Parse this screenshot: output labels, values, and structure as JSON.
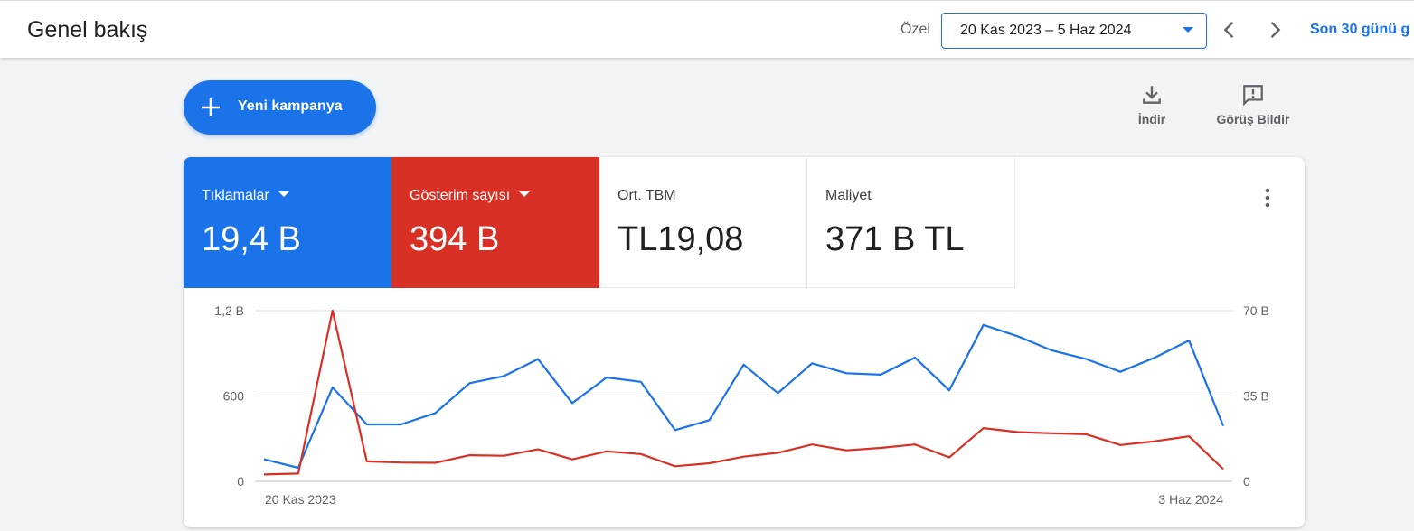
{
  "header": {
    "title": "Genel bakış",
    "date_type": "Özel",
    "date_range": "20 Kas 2023 – 5 Haz 2024",
    "quick_range": "Son 30 günü g"
  },
  "actions": {
    "new_campaign": "Yeni kampanya",
    "download": "İndir",
    "feedback": "Görüş Bildir"
  },
  "metrics": [
    {
      "label": "Tıklamalar",
      "value": "19,4 B",
      "color": "#1a73e8"
    },
    {
      "label": "Gösterim sayısı",
      "value": "394 B",
      "color": "#d93025"
    },
    {
      "label": "Ort. TBM",
      "value": "TL19,08"
    },
    {
      "label": "Maliyet",
      "value": "371 B TL"
    }
  ],
  "colors": {
    "clicks": "#1a73e8",
    "impressions": "#d93025"
  },
  "chart_data": {
    "type": "line",
    "x_tick_labels": [
      "20 Kas 2023",
      "3 Haz 2024"
    ],
    "y_left_ticks": [
      "0",
      "600",
      "1,2 B"
    ],
    "y_right_ticks": [
      "0",
      "35 B",
      "70 B"
    ],
    "ylim_left": [
      0,
      1200
    ],
    "ylim_right": [
      0,
      70000
    ],
    "grid": true,
    "series": [
      {
        "name": "Tıklamalar",
        "axis": "left",
        "color": "#1a73e8",
        "values": [
          155,
          95,
          660,
          400,
          400,
          480,
          690,
          740,
          860,
          550,
          730,
          700,
          360,
          430,
          820,
          620,
          830,
          760,
          750,
          870,
          640,
          1100,
          1020,
          920,
          860,
          770,
          870,
          990,
          390
        ]
      },
      {
        "name": "Gösterim sayısı",
        "axis": "right",
        "color": "#d93025",
        "values": [
          2800,
          3200,
          70000,
          8200,
          7700,
          7600,
          10700,
          10500,
          13100,
          9000,
          12300,
          11200,
          6200,
          7400,
          10100,
          11700,
          15100,
          12700,
          13700,
          15100,
          9800,
          21800,
          20200,
          19700,
          19300,
          14900,
          16400,
          18500,
          5000
        ]
      }
    ]
  }
}
